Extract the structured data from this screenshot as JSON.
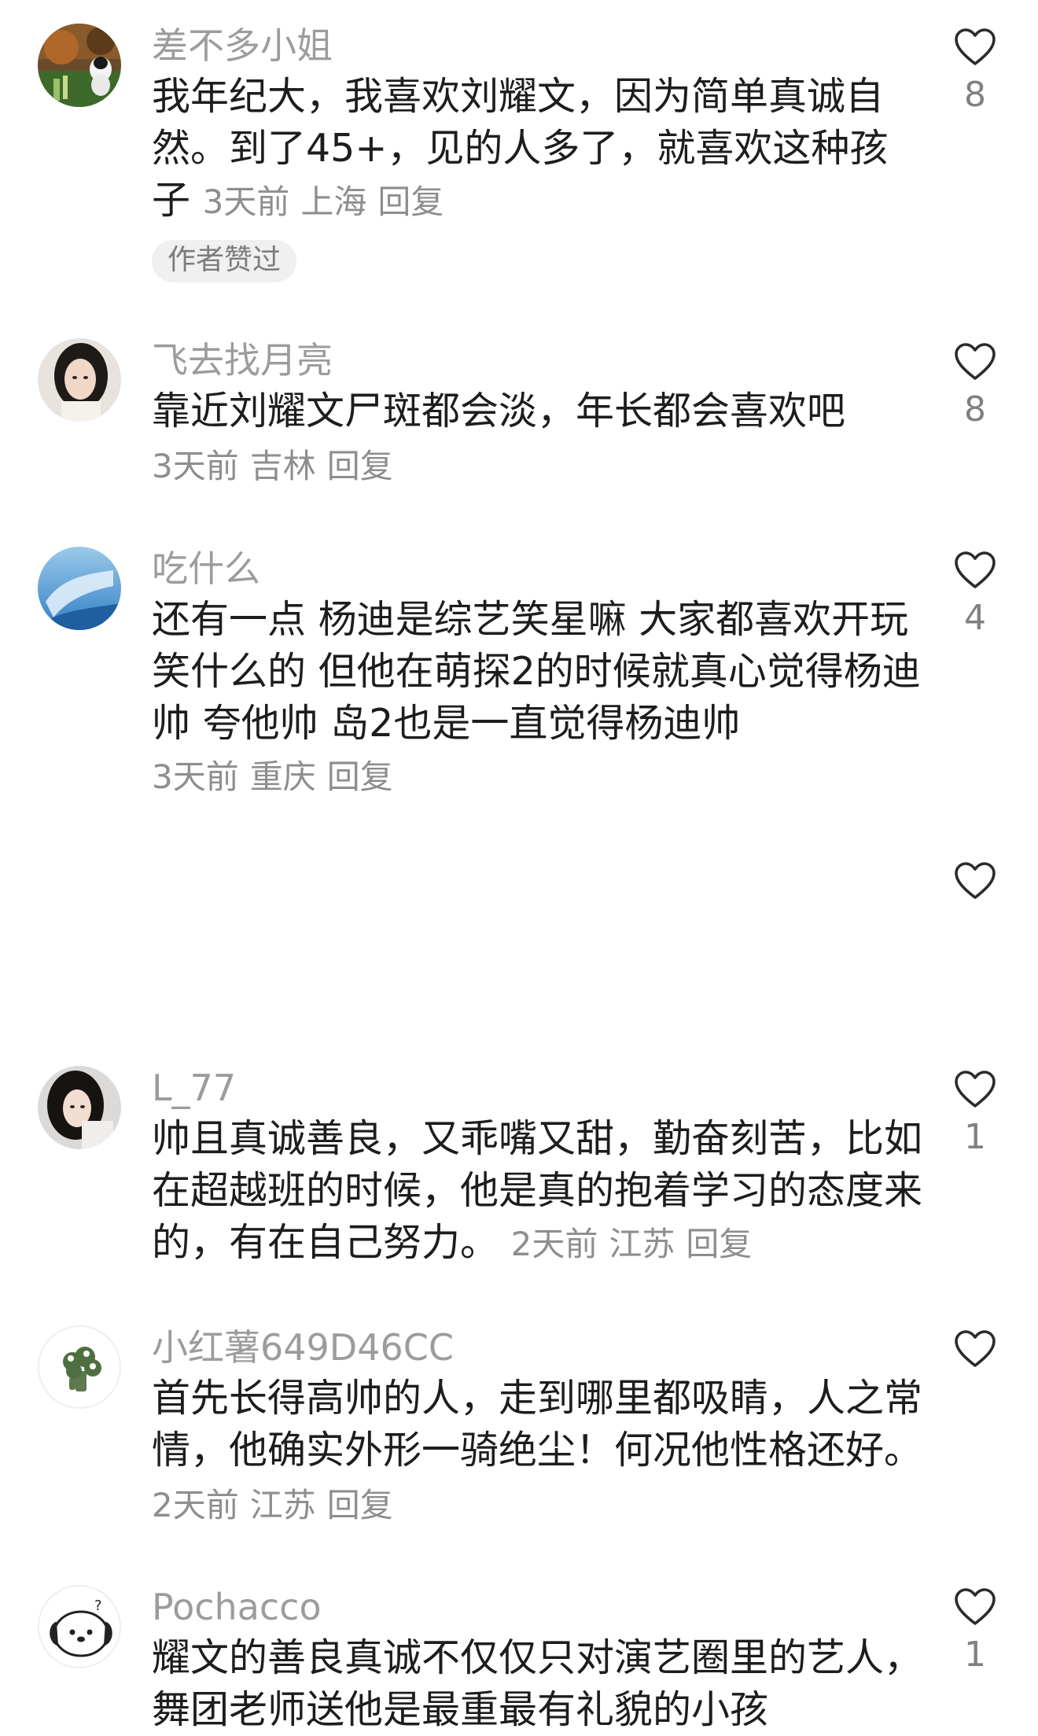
{
  "comments": [
    {
      "username": "差不多小姐",
      "text": "我年纪大，我喜欢刘耀文，因为简单真诚自然。到了45+，见的人多了，就喜欢这种孩子",
      "time": "3天前",
      "location": "上海",
      "reply": "回复",
      "tag": "作者赞过",
      "likes": "8",
      "avatar_icon": "nature-dog-avatar"
    },
    {
      "username": "飞去找月亮",
      "text": "靠近刘耀文尸斑都会淡，年长都会喜欢吧",
      "time": "3天前",
      "location": "吉林",
      "reply": "回复",
      "likes": "8",
      "avatar_icon": "girl-portrait-avatar"
    },
    {
      "username": "吃什么",
      "text": "还有一点 杨迪是综艺笑星嘛 大家都喜欢开玩笑什么的 但他在萌探2的时候就真心觉得杨迪帅 夸他帅 岛2也是一直觉得杨迪帅",
      "time": "3天前",
      "location": "重庆",
      "reply": "回复",
      "likes": "4",
      "avatar_icon": "blue-sky-avatar"
    },
    {
      "likes": ""
    },
    {
      "username": "L_77",
      "text": "帅且真诚善良，又乖嘴又甜，勤奋刻苦，比如在超越班的时候，他是真的抱着学习的态度来的，有在自己努力。",
      "time": "2天前",
      "location": "江苏",
      "reply": "回复",
      "likes": "1",
      "avatar_icon": "girl-portrait-avatar"
    },
    {
      "username": "小红薯649D46CC",
      "text": "首先长得高帅的人，走到哪里都吸睛，人之常情，他确实外形一骑绝尘！何况他性格还好。",
      "time": "2天前",
      "location": "江苏",
      "reply": "回复",
      "likes": "",
      "avatar_icon": "broccoli-avatar"
    },
    {
      "username": "Pochacco",
      "text": "耀文的善良真诚不仅仅只对演艺圈里的艺人，舞团老师送他是最重最有礼貌的小孩",
      "likes": "1",
      "avatar_icon": "pochacco-dog-avatar"
    }
  ],
  "colors": {
    "username": "#9c9c9c",
    "text": "#1d1d1d",
    "meta": "#8e8e8e",
    "tag_bg": "#f0f0f0",
    "heart": "#2b2b2b"
  }
}
